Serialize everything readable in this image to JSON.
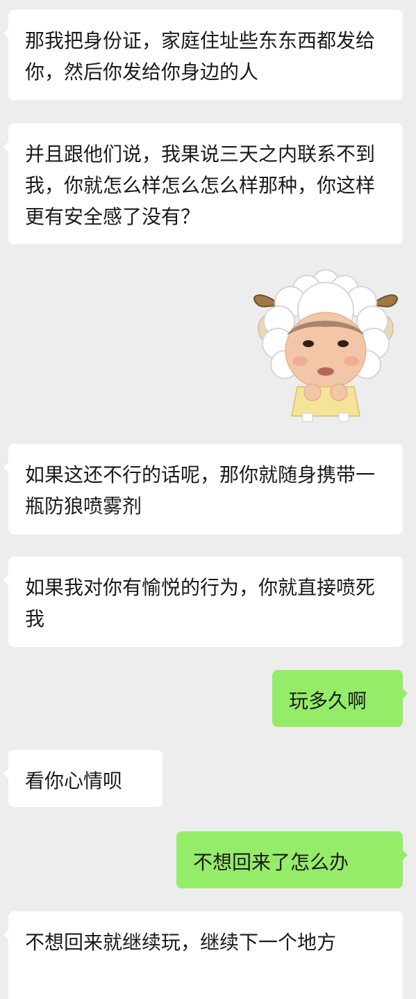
{
  "messages": [
    {
      "side": "left",
      "text": "那我把身份证，家庭住址些东东西都发给你，然后你发给你身边的人"
    },
    {
      "side": "left",
      "text": "并且跟他们说，我果说三天之内联系不到我，你就怎么样怎么怎么样那种，你这样更有安全感了没有？"
    },
    {
      "side": "left",
      "type": "sticker",
      "sticker": "sheep-costume-baby-sticker"
    },
    {
      "side": "left",
      "text": "如果这还不行的话呢，那你就随身携带一瓶防狼喷雾剂"
    },
    {
      "side": "left",
      "text": "如果我对你有愉悦的行为，你就直接喷死我"
    },
    {
      "side": "right",
      "text": "玩多久啊"
    },
    {
      "side": "left",
      "text": "看你心情呗"
    },
    {
      "side": "right",
      "text": "不想回来了怎么办"
    },
    {
      "side": "left",
      "text": "不想回来就继续玩，继续下一个地方"
    }
  ],
  "colors": {
    "background": "#ededed",
    "incoming_bubble": "#ffffff",
    "outgoing_bubble": "#95ec69",
    "text": "#1a1a1a"
  }
}
